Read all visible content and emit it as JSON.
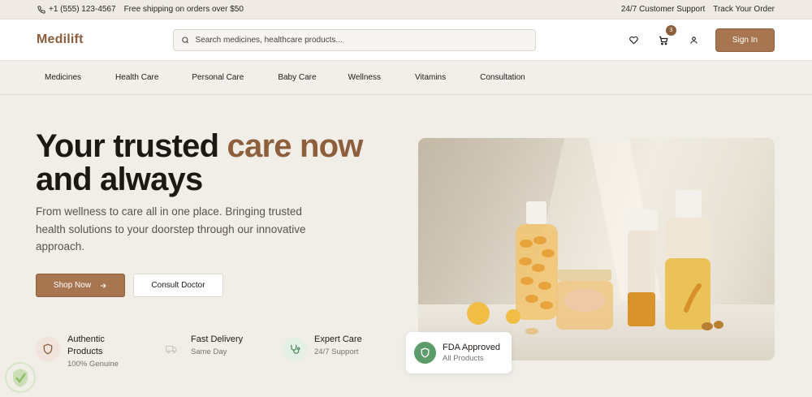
{
  "topbar": {
    "phone": "+1 (555) 123-4567",
    "shipping": "Free shipping on orders over $50",
    "support": "24/7 Customer Support",
    "track": "Track Your Order"
  },
  "header": {
    "logo": "Medilift",
    "search_placeholder": "Search medicines, healthcare products...",
    "cart_count": "3",
    "signin_label": "Sign In"
  },
  "nav": {
    "items": [
      "Medicines",
      "Health Care",
      "Personal Care",
      "Baby Care",
      "Wellness",
      "Vitamins",
      "Consultation"
    ]
  },
  "hero": {
    "headline_line1": "Your trusted ",
    "headline_accent": "care now",
    "headline_line2": "and always",
    "subtext": "From wellness to care all in one place. Bringing trusted health solutions to your doorstep through our innovative approach.",
    "shop_label": "Shop Now",
    "consult_label": "Consult Doctor"
  },
  "features": [
    {
      "title": "Authentic Products",
      "sub": "100% Genuine",
      "icon": "shield-icon"
    },
    {
      "title": "Fast Delivery",
      "sub": "Same Day",
      "icon": "truck-icon"
    },
    {
      "title": "Expert Care",
      "sub": "24/7 Support",
      "icon": "stethoscope-icon"
    }
  ],
  "fda": {
    "title": "FDA Approved",
    "sub": "All Products"
  },
  "colors": {
    "brand": "#a77650",
    "accent_text": "#8e5f3c",
    "fda_green": "#5c9b6a"
  }
}
